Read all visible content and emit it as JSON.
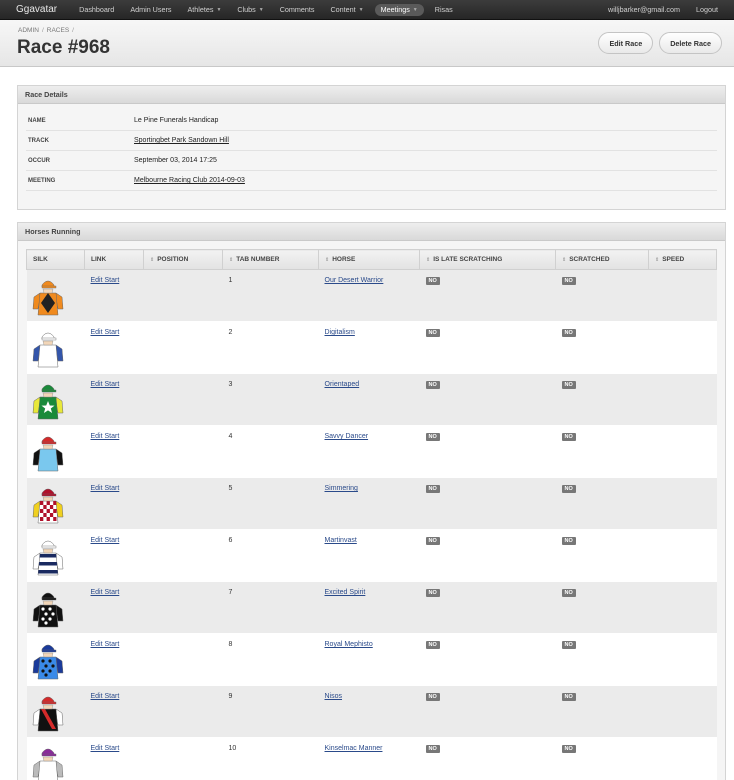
{
  "nav": {
    "brand": "Ggavatar",
    "items": [
      {
        "label": "Dashboard",
        "dropdown": false,
        "active": false
      },
      {
        "label": "Admin Users",
        "dropdown": false,
        "active": false
      },
      {
        "label": "Athletes",
        "dropdown": true,
        "active": false
      },
      {
        "label": "Clubs",
        "dropdown": true,
        "active": false
      },
      {
        "label": "Comments",
        "dropdown": false,
        "active": false
      },
      {
        "label": "Content",
        "dropdown": true,
        "active": false
      },
      {
        "label": "Meetings",
        "dropdown": true,
        "active": true
      },
      {
        "label": "Risas",
        "dropdown": false,
        "active": false
      }
    ],
    "user_email": "willjbarker@gmail.com",
    "logout": "Logout"
  },
  "header": {
    "breadcrumb": [
      "ADMIN",
      "RACES"
    ],
    "title": "Race #968",
    "edit_label": "Edit Race",
    "delete_label": "Delete Race"
  },
  "details": {
    "title": "Race Details",
    "rows": [
      {
        "label": "NAME",
        "value": "Le Pine Funerals Handicap",
        "link": false
      },
      {
        "label": "TRACK",
        "value": "Sportingbet Park Sandown Hill",
        "link": true
      },
      {
        "label": "OCCUR",
        "value": "September 03, 2014 17:25",
        "link": false
      },
      {
        "label": "MEETING",
        "value": "Melbourne Racing Club 2014-09-03",
        "link": true
      }
    ]
  },
  "horses": {
    "title": "Horses Running",
    "columns": [
      {
        "label": "SILK",
        "sortable": false
      },
      {
        "label": "LINK",
        "sortable": false
      },
      {
        "label": "POSITION",
        "sortable": true
      },
      {
        "label": "TAB NUMBER",
        "sortable": true
      },
      {
        "label": "HORSE",
        "sortable": true
      },
      {
        "label": "IS LATE SCRATCHING",
        "sortable": true
      },
      {
        "label": "SCRATCHED",
        "sortable": true
      },
      {
        "label": "SPEED",
        "sortable": true
      }
    ],
    "rows": [
      {
        "link": "Edit Start",
        "position": "",
        "tab": "1",
        "horse": "Our Desert Warrior",
        "late": "NO",
        "scratched": "NO",
        "speed": "",
        "silk": {
          "body": "#f08a1e",
          "pattern": "diamond",
          "patternColor": "#222222",
          "sleeves": "#f08a1e",
          "cap": "#f08a1e"
        }
      },
      {
        "link": "Edit Start",
        "position": "",
        "tab": "2",
        "horse": "Digitalism",
        "late": "NO",
        "scratched": "NO",
        "speed": "",
        "silk": {
          "body": "#ffffff",
          "pattern": "none",
          "patternColor": "#d33",
          "sleeves": "#3355aa",
          "cap": "#ffffff"
        }
      },
      {
        "link": "Edit Start",
        "position": "",
        "tab": "3",
        "horse": "Orientaped",
        "late": "NO",
        "scratched": "NO",
        "speed": "",
        "silk": {
          "body": "#1a8a3a",
          "pattern": "star",
          "patternColor": "#ffffff",
          "sleeves": "#e8e83a",
          "cap": "#1a8a3a"
        }
      },
      {
        "link": "Edit Start",
        "position": "",
        "tab": "4",
        "horse": "Savvy Dancer",
        "late": "NO",
        "scratched": "NO",
        "speed": "",
        "silk": {
          "body": "#7ac8ee",
          "pattern": "none",
          "patternColor": "#000",
          "sleeves": "#111111",
          "cap": "#d42a2a"
        }
      },
      {
        "link": "Edit Start",
        "position": "",
        "tab": "5",
        "horse": "Simmering",
        "late": "NO",
        "scratched": "NO",
        "speed": "",
        "silk": {
          "body": "#ffffff",
          "pattern": "checks",
          "patternColor": "#b0102a",
          "sleeves": "#f0d020",
          "cap": "#b0102a"
        }
      },
      {
        "link": "Edit Start",
        "position": "",
        "tab": "6",
        "horse": "Martinvast",
        "late": "NO",
        "scratched": "NO",
        "speed": "",
        "silk": {
          "body": "#ffffff",
          "pattern": "hoops",
          "patternColor": "#1a2a60",
          "sleeves": "#ffffff",
          "cap": "#ffffff"
        }
      },
      {
        "link": "Edit Start",
        "position": "",
        "tab": "7",
        "horse": "Excited Spirit",
        "late": "NO",
        "scratched": "NO",
        "speed": "",
        "silk": {
          "body": "#111111",
          "pattern": "spots",
          "patternColor": "#ffffff",
          "sleeves": "#111111",
          "cap": "#111111"
        }
      },
      {
        "link": "Edit Start",
        "position": "",
        "tab": "8",
        "horse": "Royal Mephisto",
        "late": "NO",
        "scratched": "NO",
        "speed": "",
        "silk": {
          "body": "#3a8ae8",
          "pattern": "spots",
          "patternColor": "#111111",
          "sleeves": "#1a3a9a",
          "cap": "#1a3a9a"
        }
      },
      {
        "link": "Edit Start",
        "position": "",
        "tab": "9",
        "horse": "Nisos",
        "late": "NO",
        "scratched": "NO",
        "speed": "",
        "silk": {
          "body": "#111111",
          "pattern": "sash",
          "patternColor": "#d42a2a",
          "sleeves": "#ffffff",
          "cap": "#d42a2a"
        }
      },
      {
        "link": "Edit Start",
        "position": "",
        "tab": "10",
        "horse": "Kinselmac Manner",
        "late": "NO",
        "scratched": "NO",
        "speed": "",
        "silk": {
          "body": "#ffffff",
          "pattern": "none",
          "patternColor": "#000",
          "sleeves": "#bbbbbb",
          "cap": "#8a2a9a"
        }
      }
    ]
  }
}
